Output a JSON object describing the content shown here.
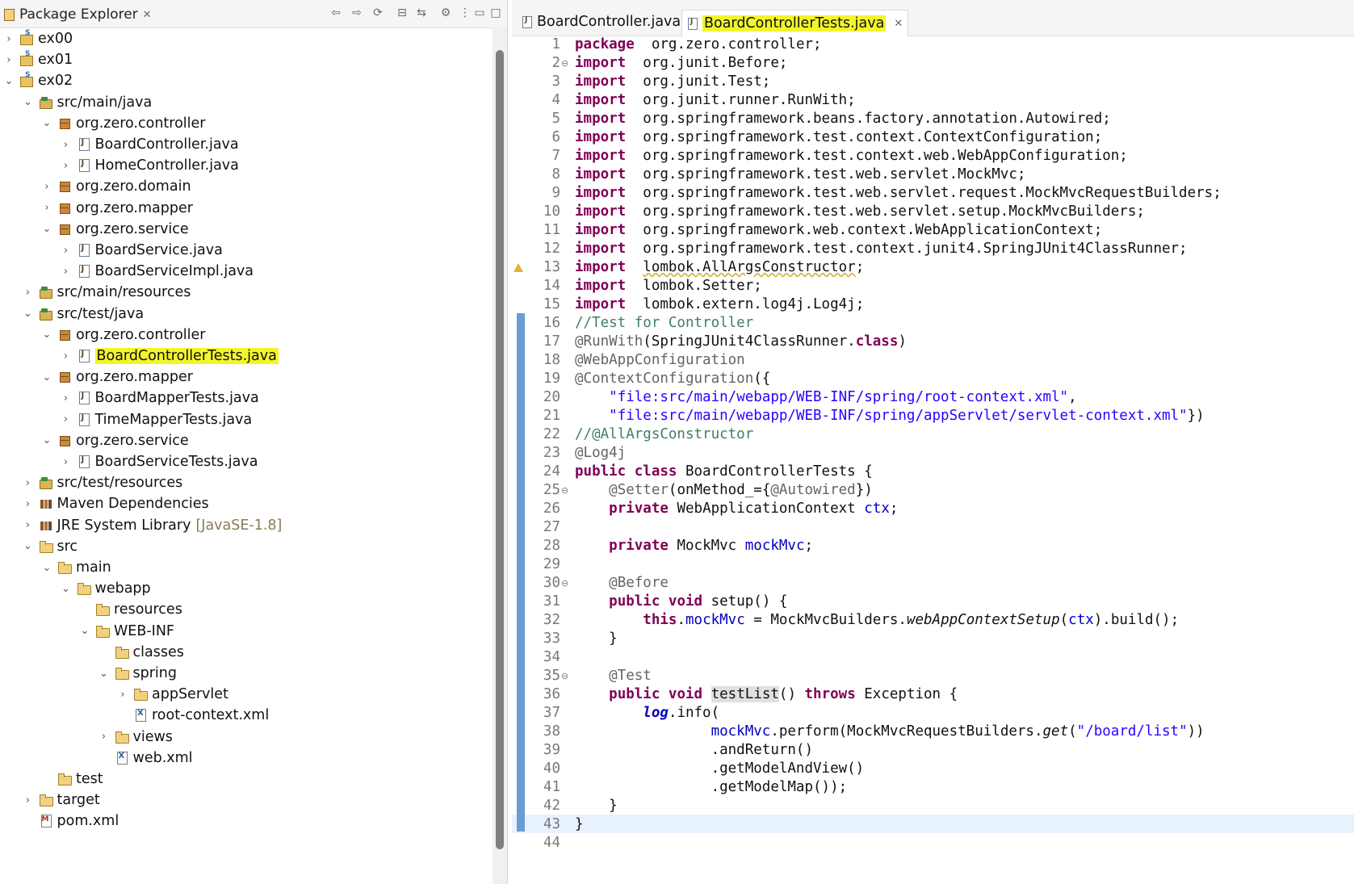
{
  "explorer": {
    "title": "Package Explorer",
    "close": "✕",
    "tree": [
      {
        "label": "ex00",
        "icon": "project",
        "indent": 0,
        "state": "collapsed"
      },
      {
        "label": "ex01",
        "icon": "project",
        "indent": 0,
        "state": "collapsed"
      },
      {
        "label": "ex02",
        "icon": "project",
        "indent": 0,
        "state": "expanded"
      },
      {
        "label": "src/main/java",
        "icon": "srcfolder",
        "indent": 1,
        "state": "expanded"
      },
      {
        "label": "org.zero.controller",
        "icon": "package",
        "indent": 2,
        "state": "expanded"
      },
      {
        "label": "BoardController.java",
        "icon": "java",
        "indent": 3,
        "state": "collapsed"
      },
      {
        "label": "HomeController.java",
        "icon": "java",
        "indent": 3,
        "state": "collapsed"
      },
      {
        "label": "org.zero.domain",
        "icon": "package",
        "indent": 2,
        "state": "collapsed"
      },
      {
        "label": "org.zero.mapper",
        "icon": "package",
        "indent": 2,
        "state": "collapsed"
      },
      {
        "label": "org.zero.service",
        "icon": "package",
        "indent": 2,
        "state": "expanded"
      },
      {
        "label": "BoardService.java",
        "icon": "java",
        "indent": 3,
        "state": "collapsed"
      },
      {
        "label": "BoardServiceImpl.java",
        "icon": "java",
        "indent": 3,
        "state": "collapsed"
      },
      {
        "label": "src/main/resources",
        "icon": "srcfolder",
        "indent": 1,
        "state": "collapsed"
      },
      {
        "label": "src/test/java",
        "icon": "srcfolder",
        "indent": 1,
        "state": "expanded"
      },
      {
        "label": "org.zero.controller",
        "icon": "package",
        "indent": 2,
        "state": "expanded"
      },
      {
        "label": "BoardControllerTests.java",
        "icon": "java",
        "indent": 3,
        "state": "collapsed",
        "highlight": true
      },
      {
        "label": "org.zero.mapper",
        "icon": "package",
        "indent": 2,
        "state": "expanded"
      },
      {
        "label": "BoardMapperTests.java",
        "icon": "java",
        "indent": 3,
        "state": "collapsed"
      },
      {
        "label": "TimeMapperTests.java",
        "icon": "java",
        "indent": 3,
        "state": "collapsed"
      },
      {
        "label": "org.zero.service",
        "icon": "package",
        "indent": 2,
        "state": "expanded"
      },
      {
        "label": "BoardServiceTests.java",
        "icon": "java",
        "indent": 3,
        "state": "collapsed"
      },
      {
        "label": "src/test/resources",
        "icon": "srcfolder",
        "indent": 1,
        "state": "collapsed"
      },
      {
        "label": "Maven Dependencies",
        "icon": "lib",
        "indent": 1,
        "state": "collapsed"
      },
      {
        "label": "JRE System Library",
        "suffix": "[JavaSE-1.8]",
        "icon": "lib",
        "indent": 1,
        "state": "collapsed"
      },
      {
        "label": "src",
        "icon": "folder",
        "indent": 1,
        "state": "expanded"
      },
      {
        "label": "main",
        "icon": "folder",
        "indent": 2,
        "state": "expanded"
      },
      {
        "label": "webapp",
        "icon": "folder",
        "indent": 3,
        "state": "expanded"
      },
      {
        "label": "resources",
        "icon": "folder",
        "indent": 4,
        "state": "none"
      },
      {
        "label": "WEB-INF",
        "icon": "folder",
        "indent": 4,
        "state": "expanded"
      },
      {
        "label": "classes",
        "icon": "folder",
        "indent": 5,
        "state": "none"
      },
      {
        "label": "spring",
        "icon": "folder",
        "indent": 5,
        "state": "expanded"
      },
      {
        "label": "appServlet",
        "icon": "folder",
        "indent": 6,
        "state": "collapsed"
      },
      {
        "label": "root-context.xml",
        "icon": "xml",
        "indent": 6,
        "state": "none"
      },
      {
        "label": "views",
        "icon": "folder",
        "indent": 5,
        "state": "collapsed"
      },
      {
        "label": "web.xml",
        "icon": "xml",
        "indent": 5,
        "state": "none"
      },
      {
        "label": "test",
        "icon": "folder",
        "indent": 2,
        "state": "none"
      },
      {
        "label": "target",
        "icon": "folder",
        "indent": 1,
        "state": "collapsed"
      },
      {
        "label": "pom.xml",
        "icon": "pom",
        "indent": 1,
        "state": "none"
      }
    ],
    "toolbar_icons": [
      "back-icon",
      "forward-icon",
      "link-icon",
      "collapse-all-icon",
      "link-with-editor-icon",
      "filter-icon",
      "view-menu-icon",
      "minimize-icon",
      "maximize-icon"
    ]
  },
  "editor": {
    "tabs": [
      {
        "label": "BoardController.java",
        "active": false
      },
      {
        "label": "BoardControllerTests.java",
        "active": true,
        "close": "✕",
        "highlight": true
      }
    ],
    "lines": [
      {
        "n": "1",
        "t": [
          [
            "kw",
            "package"
          ],
          [
            "",
            "  org.zero.controller;"
          ]
        ]
      },
      {
        "n": "2",
        "fold": "⊖",
        "t": [
          [
            "kw",
            "import"
          ],
          [
            "",
            "  org.junit.Before;"
          ]
        ]
      },
      {
        "n": "3",
        "t": [
          [
            "kw",
            "import"
          ],
          [
            "",
            "  org.junit.Test;"
          ]
        ]
      },
      {
        "n": "4",
        "t": [
          [
            "kw",
            "import"
          ],
          [
            "",
            "  org.junit.runner.RunWith;"
          ]
        ]
      },
      {
        "n": "5",
        "t": [
          [
            "kw",
            "import"
          ],
          [
            "",
            "  org.springframework.beans.factory.annotation.Autowired;"
          ]
        ]
      },
      {
        "n": "6",
        "t": [
          [
            "kw",
            "import"
          ],
          [
            "",
            "  org.springframework.test.context.ContextConfiguration;"
          ]
        ]
      },
      {
        "n": "7",
        "t": [
          [
            "kw",
            "import"
          ],
          [
            "",
            "  org.springframework.test.context.web.WebAppConfiguration;"
          ]
        ]
      },
      {
        "n": "8",
        "t": [
          [
            "kw",
            "import"
          ],
          [
            "",
            "  org.springframework.test.web.servlet.MockMvc;"
          ]
        ]
      },
      {
        "n": "9",
        "t": [
          [
            "kw",
            "import"
          ],
          [
            "",
            "  org.springframework.test.web.servlet.request.MockMvcRequestBuilders;"
          ]
        ]
      },
      {
        "n": "10",
        "t": [
          [
            "kw",
            "import"
          ],
          [
            "",
            "  org.springframework.test.web.servlet.setup.MockMvcBuilders;"
          ]
        ]
      },
      {
        "n": "11",
        "t": [
          [
            "kw",
            "import"
          ],
          [
            "",
            "  org.springframework.web.context.WebApplicationContext;"
          ]
        ]
      },
      {
        "n": "12",
        "t": [
          [
            "kw",
            "import"
          ],
          [
            "",
            "  org.springframework.test.context.junit4.SpringJUnit4ClassRunner;"
          ]
        ]
      },
      {
        "n": "13",
        "warn": true,
        "t": [
          [
            "kw",
            "import"
          ],
          [
            "",
            "  "
          ],
          [
            "sq",
            "lombok.AllArgsConstructor"
          ],
          [
            "",
            ";"
          ]
        ]
      },
      {
        "n": "14",
        "t": [
          [
            "kw",
            "import"
          ],
          [
            "",
            "  lombok.Setter;"
          ]
        ]
      },
      {
        "n": "15",
        "t": [
          [
            "kw",
            "import"
          ],
          [
            "",
            "  lombok.extern.log4j.Log4j;"
          ]
        ]
      },
      {
        "n": "16",
        "t": [
          [
            "cm",
            "//Test for Controller"
          ]
        ]
      },
      {
        "n": "17",
        "t": [
          [
            "an",
            "@RunWith"
          ],
          [
            "",
            "(SpringJUnit4ClassRunner."
          ],
          [
            "kw",
            "class"
          ],
          [
            "",
            ")"
          ]
        ]
      },
      {
        "n": "18",
        "t": [
          [
            "an",
            "@WebAppConfiguration"
          ]
        ]
      },
      {
        "n": "19",
        "t": [
          [
            "an",
            "@ContextConfiguration"
          ],
          [
            "",
            "({"
          ]
        ]
      },
      {
        "n": "20",
        "t": [
          [
            "",
            "    "
          ],
          [
            "st",
            "\"file:src/main/webapp/WEB-INF/spring/root-context.xml\""
          ],
          [
            "",
            ","
          ]
        ]
      },
      {
        "n": "21",
        "t": [
          [
            "",
            "    "
          ],
          [
            "st",
            "\"file:src/main/webapp/WEB-INF/spring/appServlet/servlet-context.xml\""
          ],
          [
            "",
            "})"
          ]
        ]
      },
      {
        "n": "22",
        "t": [
          [
            "cm",
            "//@AllArgsConstructor"
          ]
        ]
      },
      {
        "n": "23",
        "t": [
          [
            "an",
            "@Log4j"
          ]
        ]
      },
      {
        "n": "24",
        "t": [
          [
            "kw",
            "public class"
          ],
          [
            "",
            " BoardControllerTests {"
          ]
        ]
      },
      {
        "n": "25",
        "fold": "⊖",
        "t": [
          [
            "",
            "    "
          ],
          [
            "an",
            "@Setter"
          ],
          [
            "",
            "(onMethod_={"
          ],
          [
            "an",
            "@Autowired"
          ],
          [
            "",
            "})"
          ]
        ]
      },
      {
        "n": "26",
        "t": [
          [
            "",
            "    "
          ],
          [
            "kw",
            "private"
          ],
          [
            "",
            " WebApplicationContext "
          ],
          [
            "fd",
            "ctx"
          ],
          [
            "",
            ";"
          ]
        ]
      },
      {
        "n": "27",
        "t": []
      },
      {
        "n": "28",
        "t": [
          [
            "",
            "    "
          ],
          [
            "kw",
            "private"
          ],
          [
            "",
            " MockMvc "
          ],
          [
            "fd",
            "mockMvc"
          ],
          [
            "",
            ";"
          ]
        ]
      },
      {
        "n": "29",
        "t": []
      },
      {
        "n": "30",
        "fold": "⊖",
        "t": [
          [
            "",
            "    "
          ],
          [
            "an",
            "@Before"
          ]
        ]
      },
      {
        "n": "31",
        "t": [
          [
            "",
            "    "
          ],
          [
            "kw",
            "public void"
          ],
          [
            "",
            " setup() {"
          ]
        ]
      },
      {
        "n": "32",
        "t": [
          [
            "",
            "        "
          ],
          [
            "kw",
            "this"
          ],
          [
            "",
            "."
          ],
          [
            "fd",
            "mockMvc"
          ],
          [
            "",
            " = MockMvcBuilders."
          ],
          [
            "it",
            "webAppContextSetup"
          ],
          [
            "",
            "("
          ],
          [
            "fd",
            "ctx"
          ],
          [
            "",
            ").build();"
          ]
        ]
      },
      {
        "n": "33",
        "t": [
          [
            "",
            "    }"
          ]
        ]
      },
      {
        "n": "34",
        "t": []
      },
      {
        "n": "35",
        "fold": "⊖",
        "t": [
          [
            "",
            "    "
          ],
          [
            "an",
            "@Test"
          ]
        ]
      },
      {
        "n": "36",
        "t": [
          [
            "",
            "    "
          ],
          [
            "kw",
            "public void"
          ],
          [
            "",
            " "
          ],
          [
            "occ",
            "testList"
          ],
          [
            "",
            "() "
          ],
          [
            "kw",
            "throws"
          ],
          [
            "",
            " Exception {"
          ]
        ]
      },
      {
        "n": "37",
        "t": [
          [
            "",
            "        "
          ],
          [
            "fdit",
            "log"
          ],
          [
            "",
            ".info("
          ]
        ]
      },
      {
        "n": "38",
        "t": [
          [
            "",
            "                "
          ],
          [
            "fd",
            "mockMvc"
          ],
          [
            "",
            ".perform(MockMvcRequestBuilders."
          ],
          [
            "it",
            "get"
          ],
          [
            "",
            "("
          ],
          [
            "st",
            "\"/board/list\""
          ],
          [
            "",
            "))"
          ]
        ]
      },
      {
        "n": "39",
        "t": [
          [
            "",
            "                .andReturn()"
          ]
        ]
      },
      {
        "n": "40",
        "t": [
          [
            "",
            "                .getModelAndView()"
          ]
        ]
      },
      {
        "n": "41",
        "t": [
          [
            "",
            "                .getModelMap());"
          ]
        ]
      },
      {
        "n": "42",
        "t": [
          [
            "",
            "    }"
          ]
        ]
      },
      {
        "n": "43",
        "t": [
          [
            "",
            "}"
          ]
        ]
      },
      {
        "n": "44",
        "t": []
      }
    ]
  }
}
